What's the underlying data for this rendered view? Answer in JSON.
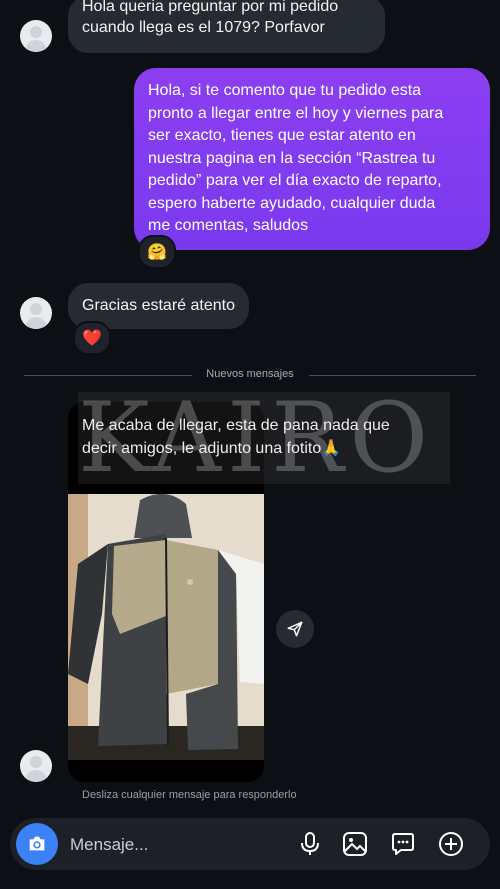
{
  "messages": {
    "incoming_1": {
      "lines": [
        "Hola queria preguntar por mi pedido",
        "cuando llega es el 1079? Porfavor"
      ]
    },
    "outgoing_1": {
      "lines": [
        "Hola, si te comento que tu pedido esta",
        "pronto a llegar entre el hoy y viernes para",
        "ser exacto, tienes que estar atento en",
        "nuestra pagina en la sección “Rastrea tu",
        "pedido” para ver el día exacto de reparto,",
        "espero haberte ayudado, cualquier duda",
        "me comentas, saludos"
      ],
      "reaction": "🤗"
    },
    "incoming_2": {
      "text": "Gracias estaré atento",
      "reaction": "❤️"
    },
    "divider": "Nuevos mensajes",
    "incoming_3": {
      "lines": [
        "Me acaba de llegar, esta de pana nada que",
        "decir amigos, le adjunto una fotito🙏"
      ],
      "watermark": "KAIRO"
    }
  },
  "hint": "Desliza cualquier mensaje para responderlo",
  "composer": {
    "placeholder": "Mensaje...",
    "icons": [
      "camera-icon",
      "microphone-icon",
      "gallery-icon",
      "sticker-icon",
      "add-icon"
    ]
  },
  "colors": {
    "background": "#0c0f14",
    "incoming_bubble": "#262a31",
    "outgoing_bubble": "#7c3aed",
    "camera_button": "#3b82f6"
  }
}
